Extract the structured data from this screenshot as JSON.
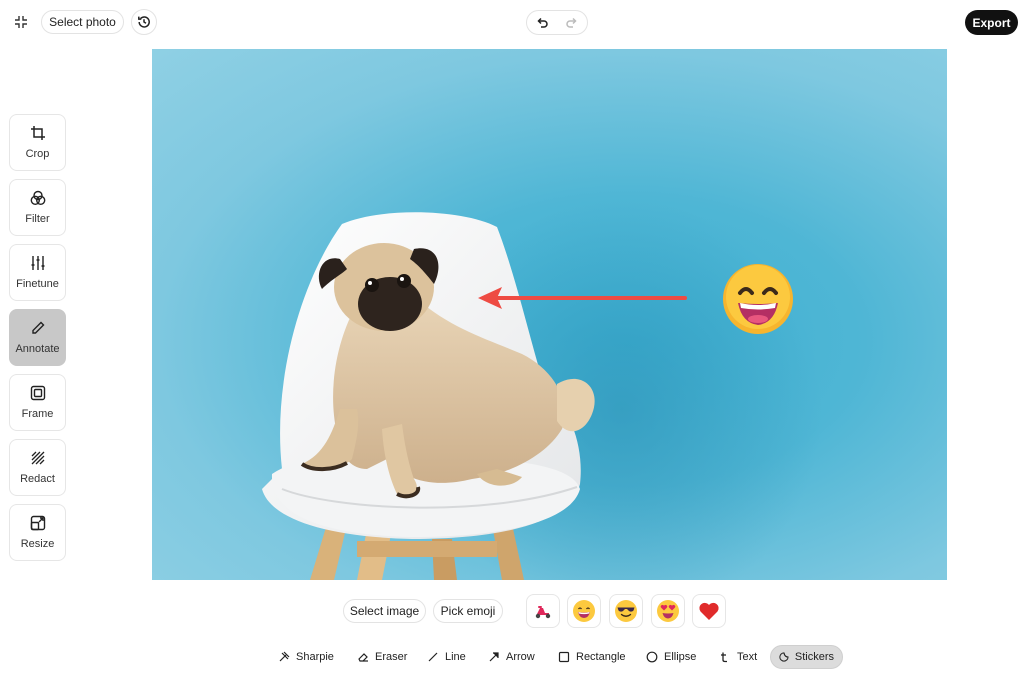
{
  "topbar": {
    "select_photo": "Select photo",
    "export": "Export",
    "icons": [
      "collapse-icon",
      "history-icon",
      "undo-icon",
      "redo-icon"
    ]
  },
  "tools": [
    {
      "label": "Crop",
      "icon": "crop-icon"
    },
    {
      "label": "Filter",
      "icon": "filter-icon"
    },
    {
      "label": "Finetune",
      "icon": "sliders-icon"
    },
    {
      "label": "Annotate",
      "icon": "pencil-icon",
      "active": true
    },
    {
      "label": "Frame",
      "icon": "frame-icon"
    },
    {
      "label": "Redact",
      "icon": "redact-icon"
    },
    {
      "label": "Resize",
      "icon": "resize-icon"
    }
  ],
  "sticker_bar": {
    "select_image": "Select image",
    "pick_emoji": "Pick emoji",
    "stickers": [
      "scooter",
      "grinning-face",
      "sunglasses-face",
      "heart-eyes-face",
      "red-heart"
    ]
  },
  "shape_tools": [
    {
      "label": "Sharpie",
      "icon": "sharpie-icon"
    },
    {
      "label": "Eraser",
      "icon": "eraser-icon"
    },
    {
      "label": "Line",
      "icon": "line-icon"
    },
    {
      "label": "Arrow",
      "icon": "arrow-icon"
    },
    {
      "label": "Rectangle",
      "icon": "rectangle-icon"
    },
    {
      "label": "Ellipse",
      "icon": "ellipse-icon"
    },
    {
      "label": "Text",
      "icon": "text-icon"
    },
    {
      "label": "Stickers",
      "icon": "sticker-icon",
      "active": true
    }
  ],
  "colors": {
    "canvas_bg": "#4fb6d5",
    "annotation_arrow": "#ee4b43",
    "active_tool_bg": "#c8c8c8",
    "export_bg": "#111111"
  }
}
